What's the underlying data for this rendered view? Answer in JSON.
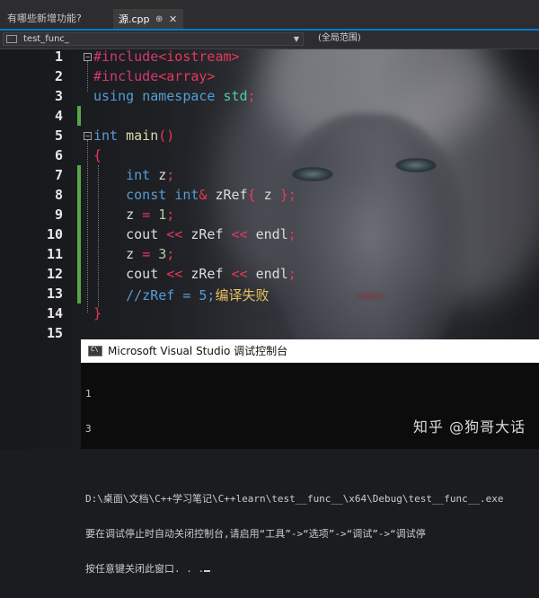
{
  "tabs": {
    "left_label": "有哪些新增功能?",
    "active_label": "源.cpp",
    "pin_glyph": "⊕",
    "close_glyph": "✕"
  },
  "nav": {
    "scope_label": "test_func_",
    "function_label": "(全局范围)"
  },
  "editor": {
    "line_numbers": [
      "1",
      "2",
      "3",
      "4",
      "5",
      "6",
      "7",
      "8",
      "9",
      "10",
      "11",
      "12",
      "13",
      "14",
      "15"
    ]
  },
  "console": {
    "title": "Microsoft Visual Studio 调试控制台",
    "logo_text": "C\\",
    "lines": [
      "1",
      "3",
      "",
      "D:\\桌面\\文档\\C++学习笔记\\C++learn\\test__func__\\x64\\Debug\\test__func__.exe",
      "要在调试停止时自动关闭控制台,请启用“工具”->“选项”->“调试”->“调试停",
      "按任意键关闭此窗口. . ."
    ]
  },
  "watermark": "知乎 @狗哥大话",
  "colors": {
    "accent": "#007acc",
    "change_bar": "#57a64a"
  }
}
